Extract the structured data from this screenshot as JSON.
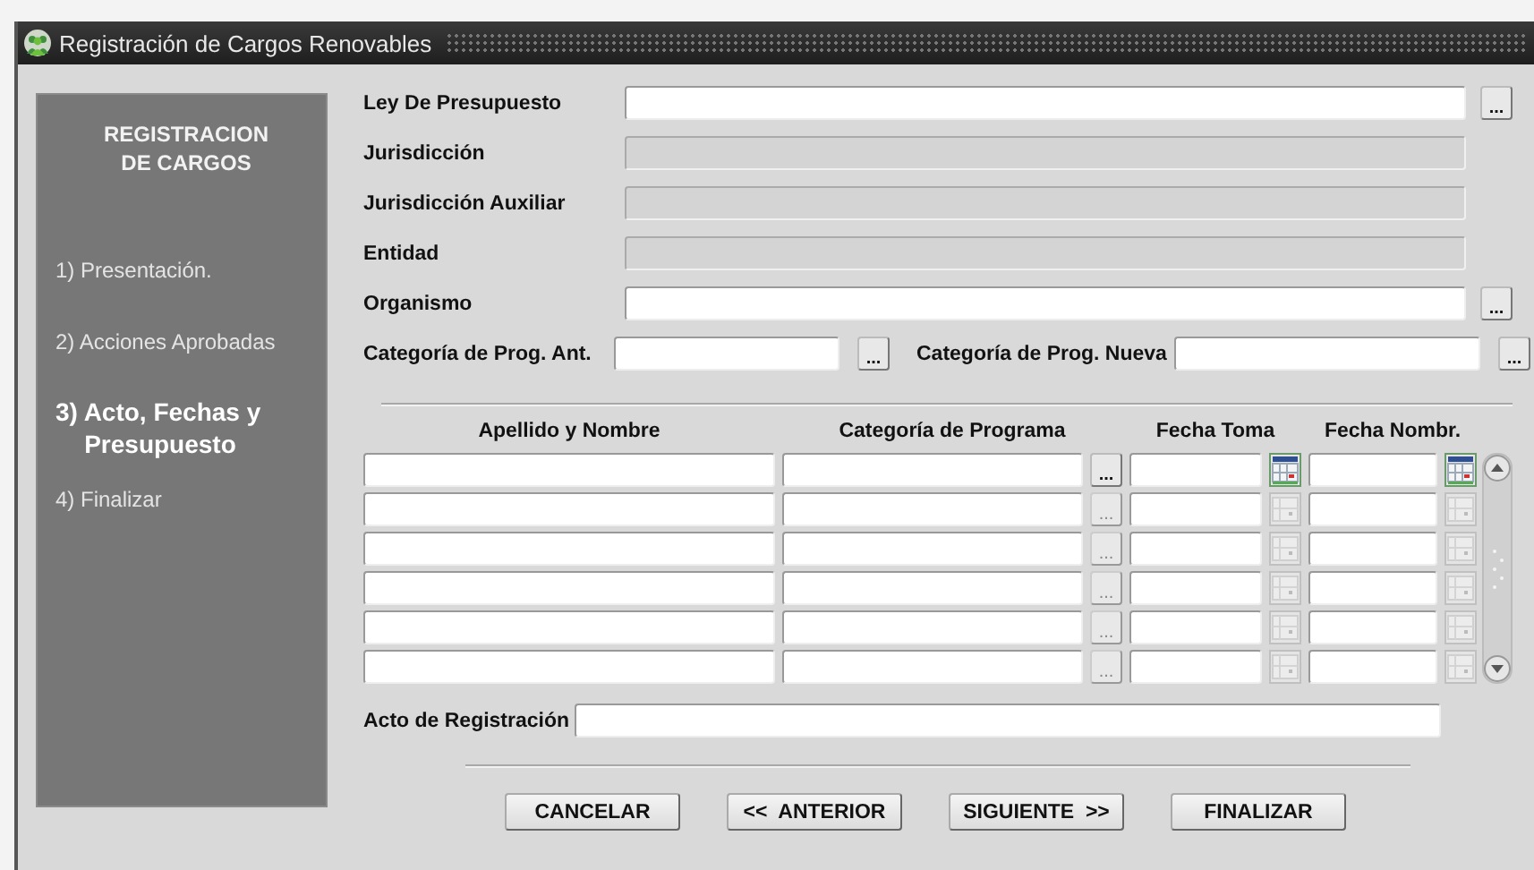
{
  "window": {
    "title": "Registración de Cargos Renovables"
  },
  "sidebar": {
    "title": "REGISTRACION DE CARGOS",
    "steps": [
      {
        "label": "1) Presentación.",
        "selected": false
      },
      {
        "label": "2) Acciones Aprobadas",
        "selected": false
      },
      {
        "label": "3) Acto, Fechas y Presupuesto",
        "selected": true
      },
      {
        "label": "4) Finalizar",
        "selected": false
      }
    ]
  },
  "fields": [
    {
      "label": "Ley De Presupuesto",
      "enabled": true,
      "button": "..."
    },
    {
      "label": "Jurisdicción",
      "enabled": false
    },
    {
      "label": "Jurisdicción Auxiliar",
      "enabled": false
    },
    {
      "label": "Entidad",
      "enabled": false
    },
    {
      "label": "Organismo",
      "enabled": true,
      "button": "..."
    }
  ],
  "category_fields": [
    {
      "label": "Categoría de Prog. Ant.",
      "button": "..."
    },
    {
      "label": "Categoría de Prog. Nueva",
      "button": "..."
    }
  ],
  "table": {
    "columns": [
      "Apellido y Nombre",
      "Categoría de Programa",
      "Fecha Toma",
      "Fecha Nombr."
    ],
    "rows": [
      {
        "active": true,
        "lookup_button": "..."
      },
      {
        "active": false,
        "lookup_button": "..."
      },
      {
        "active": false,
        "lookup_button": "..."
      },
      {
        "active": false,
        "lookup_button": "..."
      },
      {
        "active": false,
        "lookup_button": "..."
      },
      {
        "active": false,
        "lookup_button": "..."
      }
    ]
  },
  "acto": {
    "label": "Acto de Registración"
  },
  "buttons": [
    "CANCELAR",
    "<<  ANTERIOR",
    "SIGUIENTE  >>",
    "FINALIZAR"
  ]
}
